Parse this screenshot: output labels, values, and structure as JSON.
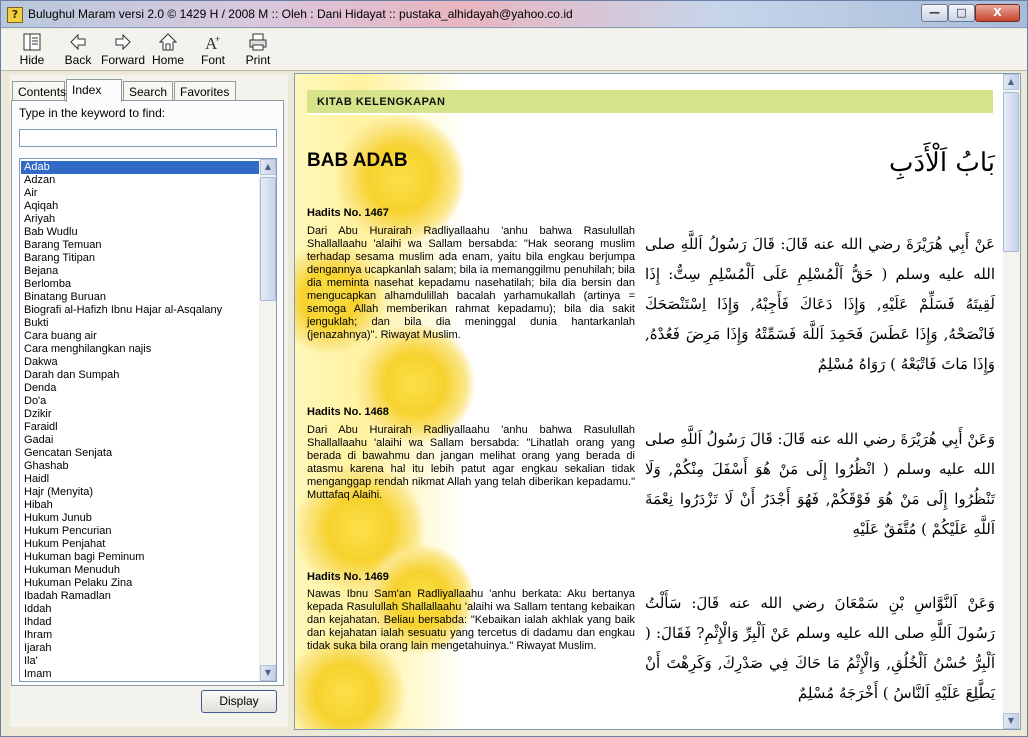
{
  "window": {
    "title": "Bulughul Maram versi 2.0 © 1429 H / 2008 M :: Oleh : Dani Hidayat :: pustaka_alhidayah@yahoo.co.id",
    "min": "—",
    "max": "□",
    "close": "X"
  },
  "toolbar": {
    "hide": "Hide",
    "back": "Back",
    "forward": "Forward",
    "home": "Home",
    "font": "Font",
    "print": "Print"
  },
  "tabs": [
    "Contents",
    "Index",
    "Search",
    "Favorites"
  ],
  "index": {
    "keyword_label": "Type in the keyword to find:",
    "keyword_value": "",
    "items": [
      "Adab",
      "Adzan",
      "Air",
      "Aqiqah",
      "Ariyah",
      "Bab Wudlu",
      "Barang Temuan",
      "Barang Titipan",
      "Bejana",
      "Berlomba",
      "Binatang Buruan",
      "Biografi al-Hafizh Ibnu Hajar al-Asqalany",
      "Bukti",
      "Cara buang air",
      "Cara menghilangkan najis",
      "Dakwa",
      "Darah dan Sumpah",
      "Denda",
      "Do'a",
      "Dzikir",
      "Faraidl",
      "Gadai",
      "Gencatan Senjata",
      "Ghashab",
      "Haidl",
      "Hajr (Menyita)",
      "Hibah",
      "Hukum Junub",
      "Hukum Pencurian",
      "Hukum Penjahat",
      "Hukuman bagi Peminum",
      "Hukuman Menuduh",
      "Hukuman Pelaku Zina",
      "Ibadah Ramadlan",
      "Iddah",
      "Ihdad",
      "Ihram",
      "Ijarah",
      "Ila'",
      "Imam"
    ],
    "selected": "Adab",
    "display_button": "Display"
  },
  "content": {
    "header": "KITAB KELENGKAPAN",
    "bab_title": "BAB ADAB",
    "bab_arabic": "بَابُ اَلْأَدَبِ",
    "hadits": [
      {
        "number": "Hadits No. 1467",
        "text": "Dari Abu Hurairah Radliyallaahu 'anhu bahwa Rasulullah Shallallaahu 'alaihi wa Sallam bersabda: \"Hak seorang muslim terhadap sesama muslim ada enam, yaitu bila engkau berjumpa dengannya ucapkanlah salam; bila ia memanggilmu penuhilah; bila dia meminta nasehat kepadamu nasehatilah; bila dia bersin dan mengucapkan alhamdulillah bacalah yarhamukallah (artinya = semoga Allah memberikan rahmat kepadamu); bila dia sakit jenguklah; dan bila dia meninggal dunia hantarkanlah (jenazahnya)\". Riwayat Muslim.",
        "arabic": "عَنْ أَبِي هُرَيْرَةَ رضي الله عنه قَالَ: قَالَ رَسُولُ اَللَّهِ صلى الله عليه وسلم ( حَقُّ اَلْمُسْلِمِ عَلَى اَلْمُسْلِمِ سِتٌّ: إِذَا لَقِيتَهُ فَسَلِّمْ عَلَيْهِ, وَإِذَا دَعَاكَ فَأَجِبْهُ, وَإِذَا اِسْتَنْصَحَكَ فَانْصَحْهُ, وَإِذَا عَطَسَ فَحَمِدَ اَللَّهَ فَسَمِّتْهُ وَإِذَا مَرِضَ فَعُدْهُ, وَإِذَا مَاتَ فَاتْبَعْهُ ) رَوَاهُ مُسْلِمٌ"
      },
      {
        "number": "Hadits No. 1468",
        "text": "Dari Abu Hurairah Radliyallaahu 'anhu bahwa Rasulullah Shallallaahu 'alaihi wa Sallam bersabda: \"Lihatlah orang yang berada di bawahmu dan jangan melihat orang yang berada di atasmu karena hal itu lebih patut agar engkau sekalian tidak menganggap rendah nikmat Allah yang telah diberikan kepadamu.\" Muttafaq Alaihi.",
        "arabic": "وَعَنْ أَبِي هُرَيْرَةَ رضي الله عنه قَالَ: قَالَ رَسُولُ اَللَّهِ صلى الله عليه وسلم ( انْظُرُوا إِلَى مَنْ هُوَ أَسْفَلَ مِنْكُمْ, وَلَا تَنْظُرُوا إِلَى مَنْ هُوَ فَوْقَكُمْ, فَهُوَ أَجْدَرُ أَنْ لَا تَزْدَرُوا نِعْمَةَ اَللَّهِ عَلَيْكُمْ ) مُتَّفَقٌ عَلَيْهِ"
      },
      {
        "number": "Hadits No. 1469",
        "text": "Nawas Ibnu Sam'an Radliyallaahu 'anhu berkata: Aku bertanya kepada Rasulullah Shallallaahu 'alaihi wa Sallam tentang kebaikan dan kejahatan. Beliau bersabda: \"Kebaikan ialah akhlak yang baik dan kejahatan ialah sesuatu yang tercetus di dadamu dan engkau tidak suka bila orang lain mengetahuinya.\" Riwayat Muslim.",
        "arabic": "وَعَنْ اَلنَّوَّاسِ بْنِ سَمْعَانَ رضي الله عنه قَالَ: سَأَلْتُ رَسُولَ اَللَّهِ صلى الله عليه وسلم عَنْ اَلْبِرِّ وَالْإِثْمِ? فَقَالَ: ( اَلْبِرُّ حُسْنُ اَلْخُلُقِ, وَالْإِثْمُ مَا حَاكَ فِي صَدْرِكَ, وَكَرِهْتَ أَنْ يَطَّلِعَ عَلَيْهِ اَلنَّاسُ ) أَخْرَجَهُ مُسْلِمٌ"
      }
    ]
  },
  "colors": {
    "header_bar": "#d6e38a",
    "selection": "#316ac5",
    "flower": "#f7d22e"
  }
}
